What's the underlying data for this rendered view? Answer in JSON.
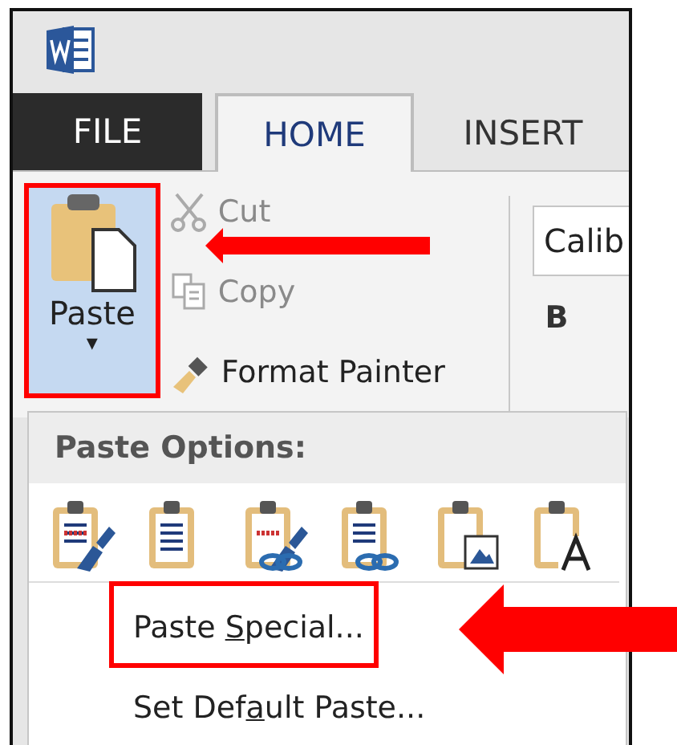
{
  "tabs": [
    {
      "label": "FILE",
      "kind": "file",
      "selected": false
    },
    {
      "label": "HOME",
      "kind": "tab",
      "selected": true
    },
    {
      "label": "INSERT",
      "kind": "tab",
      "selected": false
    }
  ],
  "clipboard": {
    "paste": {
      "label": "Paste",
      "caret": "▾"
    },
    "commands": [
      {
        "label": "Cut",
        "kind": "cut",
        "disabled": true
      },
      {
        "label": "Copy",
        "kind": "copy",
        "disabled": true
      },
      {
        "label": "Format Painter",
        "kind": "painter",
        "disabled": false
      }
    ]
  },
  "font": {
    "name": "Calib",
    "bold": "B"
  },
  "paste_menu": {
    "title": "Paste Options:",
    "options": [
      {
        "kind": "keep-source"
      },
      {
        "kind": "merge"
      },
      {
        "kind": "link-source"
      },
      {
        "kind": "link-merge"
      },
      {
        "kind": "picture"
      },
      {
        "kind": "text-only"
      }
    ],
    "items": [
      {
        "label_start": "Paste ",
        "access_key": "S",
        "label_end": "pecial...",
        "highlighted": true
      },
      {
        "label_start": "Set Def",
        "access_key": "a",
        "label_end": "ult Paste...",
        "highlighted": false
      }
    ]
  }
}
